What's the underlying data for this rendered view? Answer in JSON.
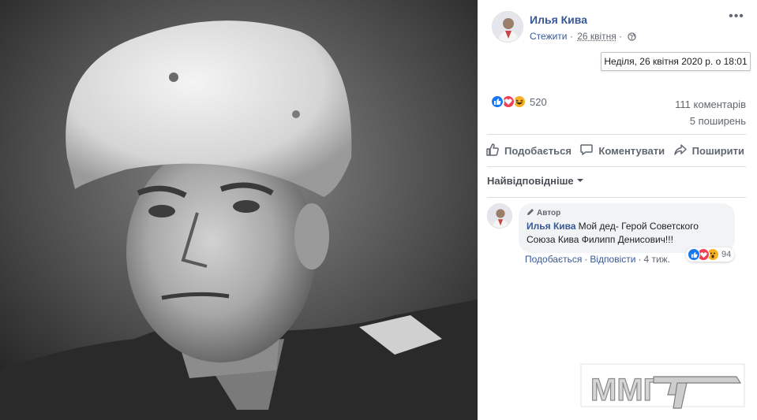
{
  "post": {
    "author": "Илья Кива",
    "follow_label": "Стежити",
    "date_short": "26 квітня",
    "date_tooltip": "Неділя, 26 квітня 2020 р. о 18:01",
    "reaction_count": "520",
    "comments_count": "111 коментарів",
    "shares_count": "5 поширень"
  },
  "actions": {
    "like": "Подобається",
    "comment": "Коментувати",
    "share": "Поширити"
  },
  "sort_label": "Найвідповідніше",
  "comment": {
    "badge": "Автор",
    "author": "Илья Кива",
    "text": "Мой дед- Герой Советского Союза Кива Филипп Денисович!!!",
    "like_label": "Подобається",
    "reply_label": "Відповісти",
    "time": "4 тиж.",
    "reaction_count": "94"
  },
  "watermark": "ММГ",
  "colors": {
    "link": "#385898",
    "like": "#1877f2",
    "love": "#f33e58",
    "haha": "#f7b125"
  },
  "icons": [
    "globe-icon",
    "more-icon",
    "like-icon",
    "comment-icon",
    "share-icon",
    "pencil-icon"
  ]
}
